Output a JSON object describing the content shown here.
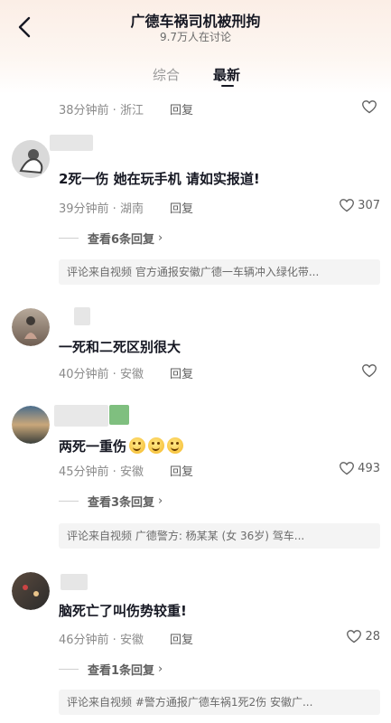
{
  "header": {
    "title": "广德车祸司机被刑拘",
    "subtitle": "9.7万人在讨论",
    "tabs": [
      {
        "label": "综合",
        "active": false
      },
      {
        "label": "最新",
        "active": true
      }
    ]
  },
  "colors": {
    "text": "#161823",
    "meta": "#8a8a8a",
    "source_bg": "#f4f4f4"
  },
  "comments": [
    {
      "time_location": "38分钟前 · 浙江",
      "reply_label": "回复",
      "likes": ""
    },
    {
      "content": "2死一伤 她在玩手机 请如实报道!",
      "time_location": "39分钟前 · 湖南",
      "reply_label": "回复",
      "likes": "307",
      "expand_label": "查看6条回复",
      "source": "评论来自视频 官方通报安徽广德一车辆冲入绿化带..."
    },
    {
      "content": "一死和二死区别很大",
      "time_location": "40分钟前 · 安徽",
      "reply_label": "回复",
      "likes": ""
    },
    {
      "content": "两死一重伤",
      "time_location": "45分钟前 · 安徽",
      "reply_label": "回复",
      "likes": "493",
      "expand_label": "查看3条回复",
      "source": "评论来自视频 广德警方: 杨某某 (女 36岁) 驾车..."
    },
    {
      "content": "脑死亡了叫伤势较重!",
      "time_location": "46分钟前 · 安徽",
      "reply_label": "回复",
      "likes": "28",
      "expand_label": "查看1条回复",
      "source": "评论来自视频 #警方通报广德车祸1死2伤 安徽广..."
    }
  ]
}
